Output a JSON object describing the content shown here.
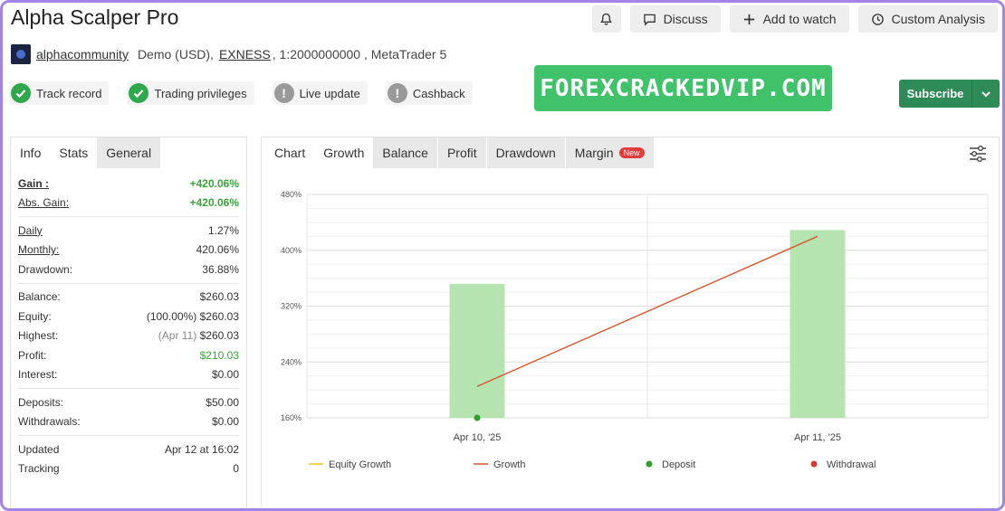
{
  "header": {
    "title": "Alpha Scalper Pro",
    "buttons": {
      "discuss": "Discuss",
      "watch": "Add to watch",
      "custom": "Custom Analysis"
    }
  },
  "account": {
    "user": "alphacommunity",
    "type": "Demo (USD),",
    "broker": "EXNESS",
    "rest": ", 1:2000000000 , MetaTrader 5"
  },
  "badges": [
    "Track record",
    "Trading privileges",
    "Live update",
    "Cashback"
  ],
  "watermark": "FOREXCRACKEDVIP.COM",
  "subscribe": "Subscribe",
  "left_tabs": [
    "Info",
    "Stats",
    "General"
  ],
  "stats": {
    "gain_k": "Gain :",
    "gain_v": "+420.06%",
    "absgain_k": "Abs. Gain:",
    "absgain_v": "+420.06%",
    "daily_k": "Daily",
    "daily_v": "1.27%",
    "monthly_k": "Monthly:",
    "monthly_v": "420.06%",
    "drawdown_k": "Drawdown:",
    "drawdown_v": "36.88%",
    "balance_k": "Balance:",
    "balance_v": "$260.03",
    "equity_k": "Equity:",
    "equity_pct": "(100.00%)",
    "equity_v": "$260.03",
    "highest_k": "Highest:",
    "highest_date": "(Apr 11)",
    "highest_v": "$260.03",
    "profit_k": "Profit:",
    "profit_v": "$210.03",
    "interest_k": "Interest:",
    "interest_v": "$0.00",
    "deposits_k": "Deposits:",
    "deposits_v": "$50.00",
    "withdrawals_k": "Withdrawals:",
    "withdrawals_v": "$0.00",
    "updated_k": "Updated",
    "updated_v": "Apr 12 at 16:02",
    "tracking_k": "Tracking",
    "tracking_v": "0"
  },
  "chart_tabs": [
    "Chart",
    "Growth",
    "Balance",
    "Profit",
    "Drawdown",
    "Margin"
  ],
  "new_badge": "New",
  "chart_data": {
    "type": "bar",
    "categories": [
      "Apr 10, '25",
      "Apr 11, '25"
    ],
    "ylim": [
      160,
      480
    ],
    "yticks": [
      "480%",
      "400%",
      "320%",
      "240%",
      "160%"
    ],
    "ytick_values": [
      480,
      400,
      320,
      240,
      160
    ],
    "series": [
      {
        "name": "Equity Growth",
        "type": "line",
        "values": [],
        "color": "#f0c419"
      },
      {
        "name": "Growth",
        "type": "line",
        "values": [
          205,
          420
        ],
        "color": "#d9552c"
      },
      {
        "name": "Deposit",
        "type": "marker",
        "values": [
          160,
          null
        ],
        "color": "#2e9e2e"
      },
      {
        "name": "Withdrawal",
        "type": "marker",
        "values": [
          null,
          null
        ],
        "color": "#d93a2e"
      }
    ],
    "bars": {
      "values": [
        352,
        429
      ],
      "color": "#b5e4b0"
    },
    "legend": "bottom"
  }
}
